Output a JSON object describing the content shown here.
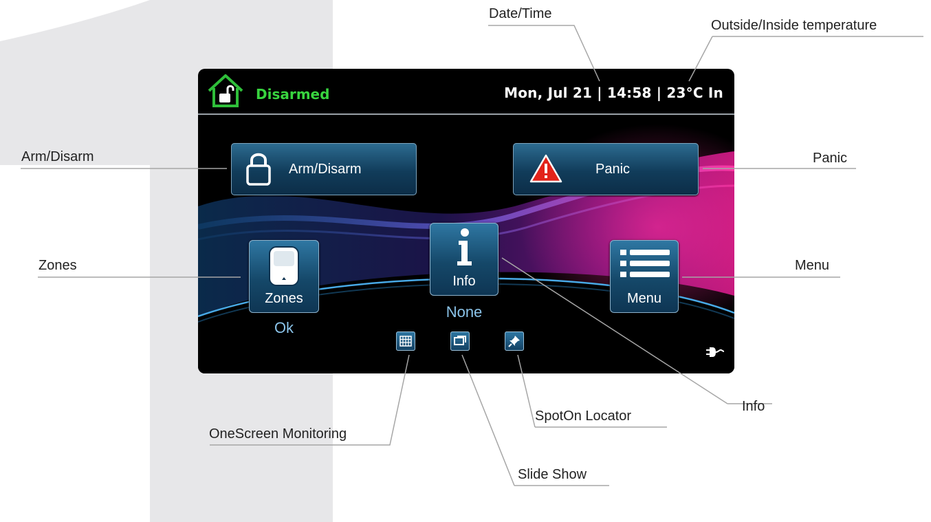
{
  "screen": {
    "header": {
      "status": "Disarmed",
      "datetime": "Mon, Jul 21 | 14:58 | 23°C In"
    },
    "buttons": {
      "arm_disarm": "Arm/Disarm",
      "panic": "Panic"
    },
    "tiles": {
      "zones": {
        "label": "Zones",
        "status": "Ok"
      },
      "info": {
        "label": "Info",
        "status": "None"
      },
      "menu": {
        "label": "Menu"
      }
    }
  },
  "callouts": {
    "date_time": "Date/Time",
    "temperature": "Outside/Inside temperature",
    "arm_disarm": "Arm/Disarm",
    "panic": "Panic",
    "zones": "Zones",
    "menu": "Menu",
    "info": "Info",
    "onescreen": "OneScreen Monitoring",
    "spoton": "SpotOn Locator",
    "slideshow": "Slide Show"
  },
  "colors": {
    "status_green": "#38d43f",
    "button_blue": "#154869",
    "caption_blue": "#8bc4ea",
    "panic_red": "#e2231a"
  },
  "icons": [
    "home-unlocked-icon",
    "padlock-icon",
    "warning-icon",
    "zone-sensor-icon",
    "info-icon",
    "menu-list-icon",
    "grid-icon",
    "slides-icon",
    "pushpin-icon",
    "power-plug-icon"
  ]
}
